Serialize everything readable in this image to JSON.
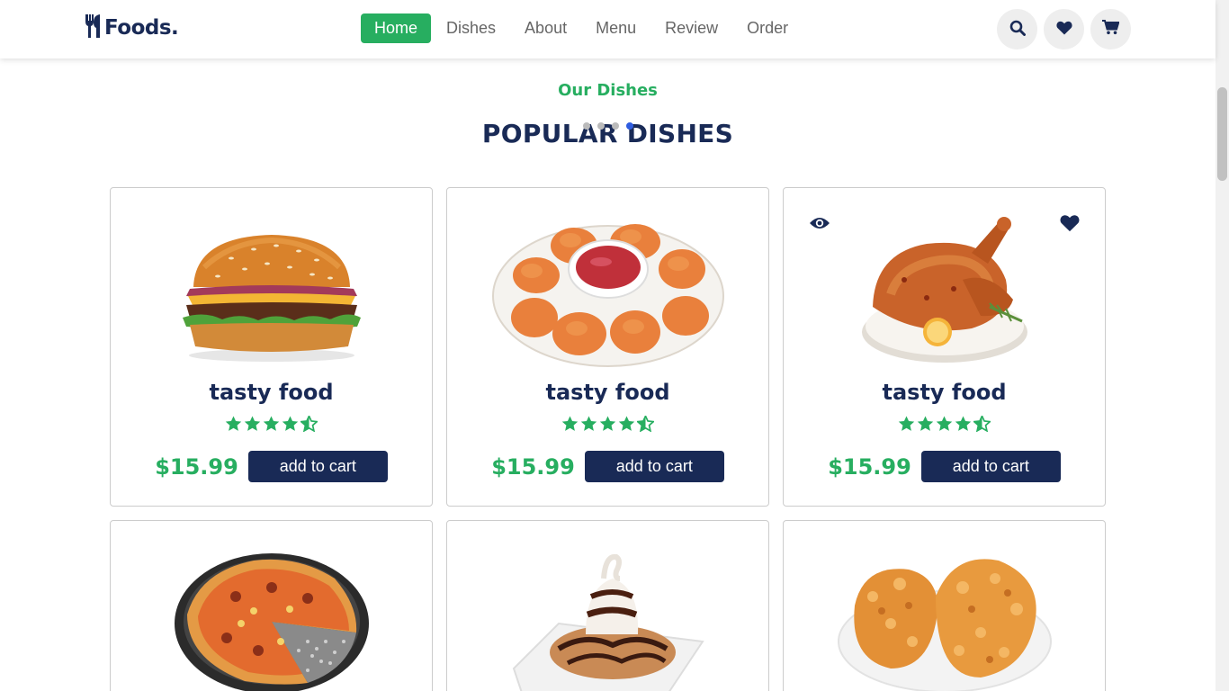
{
  "header": {
    "logo": "Foods.",
    "nav": [
      "Home",
      "Dishes",
      "About",
      "Menu",
      "Review",
      "Order"
    ],
    "active_nav": "Home",
    "icons": [
      "search-icon",
      "heart-icon",
      "cart-icon"
    ]
  },
  "section": {
    "sub_heading": "Our Dishes",
    "heading": "POPULAR DISHES",
    "carousel_dots": 4,
    "active_dot": 4
  },
  "dishes": [
    {
      "image": "burger",
      "title": "tasty food",
      "rating": 4.5,
      "price": "$15.99",
      "button": "add to cart"
    },
    {
      "image": "chicken-nuggets",
      "title": "tasty food",
      "rating": 4.5,
      "price": "$15.99",
      "button": "add to cart"
    },
    {
      "image": "roast-chicken",
      "title": "tasty food",
      "rating": 4.5,
      "price": "$15.99",
      "button": "add to cart",
      "hover_icons": [
        "eye-icon",
        "heart-icon"
      ]
    },
    {
      "image": "pizza"
    },
    {
      "image": "chocolate-dessert"
    },
    {
      "image": "fried-chicken"
    }
  ],
  "colors": {
    "brand_green": "#27ae60",
    "navy": "#192a56",
    "nav_text": "#666666",
    "icon_bg": "#eeeeee"
  }
}
